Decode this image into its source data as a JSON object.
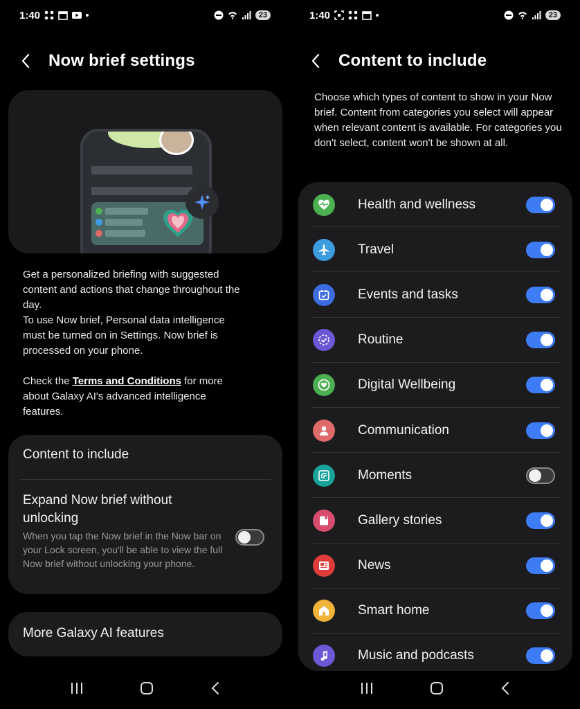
{
  "left": {
    "status": {
      "time": "1:40",
      "battery": "23"
    },
    "title": "Now brief settings",
    "desc_lines": [
      "Get a personalized briefing with suggested",
      "content and actions that change throughout the",
      "day.",
      "To use Now brief, Personal data intelligence",
      "must be turned on in Settings. Now brief is",
      "processed on your phone."
    ],
    "terms_prefix": "Check the ",
    "terms_link": "Terms and Conditions",
    "terms_suffix_lines": [
      " for more",
      "about Galaxy AI's advanced intelligence",
      "features."
    ],
    "content_to_include": "Content to include",
    "expand_title": "Expand Now brief without unlocking",
    "expand_sub": "When you tap the Now brief in the Now bar on your Lock screen, you'll be able to view the full Now brief without unlocking your phone.",
    "expand_on": false,
    "more_features": "More Galaxy AI features"
  },
  "right": {
    "status": {
      "time": "1:40",
      "battery": "23"
    },
    "title": "Content to include",
    "description": "Choose which types of content to show in your Now brief. Content from categories you select will appear when relevant content is available. For categories you don't select, content won't be shown at all.",
    "items": [
      {
        "label": "Health and wellness",
        "on": true,
        "icon": "heart-pulse-icon",
        "color": "#4caf50"
      },
      {
        "label": "Travel",
        "on": true,
        "icon": "airplane-icon",
        "color": "#3d9be0"
      },
      {
        "label": "Events and tasks",
        "on": true,
        "icon": "calendar-check-icon",
        "color": "#3b6ce0"
      },
      {
        "label": "Routine",
        "on": true,
        "icon": "routine-check-icon",
        "color": "#6b58d6"
      },
      {
        "label": "Digital Wellbeing",
        "on": true,
        "icon": "wellbeing-heart-icon",
        "color": "#4caf50"
      },
      {
        "label": "Communication",
        "on": true,
        "icon": "person-icon",
        "color": "#e06a6a"
      },
      {
        "label": "Moments",
        "on": false,
        "icon": "moments-icon",
        "color": "#1aa39a"
      },
      {
        "label": "Gallery stories",
        "on": true,
        "icon": "gallery-icon",
        "color": "#d84d6e"
      },
      {
        "label": "News",
        "on": true,
        "icon": "news-icon",
        "color": "#e03c3c"
      },
      {
        "label": "Smart home",
        "on": true,
        "icon": "home-icon",
        "color": "#f1b33a"
      },
      {
        "label": "Music and podcasts",
        "on": true,
        "icon": "music-note-icon",
        "color": "#6b58d6"
      }
    ]
  }
}
